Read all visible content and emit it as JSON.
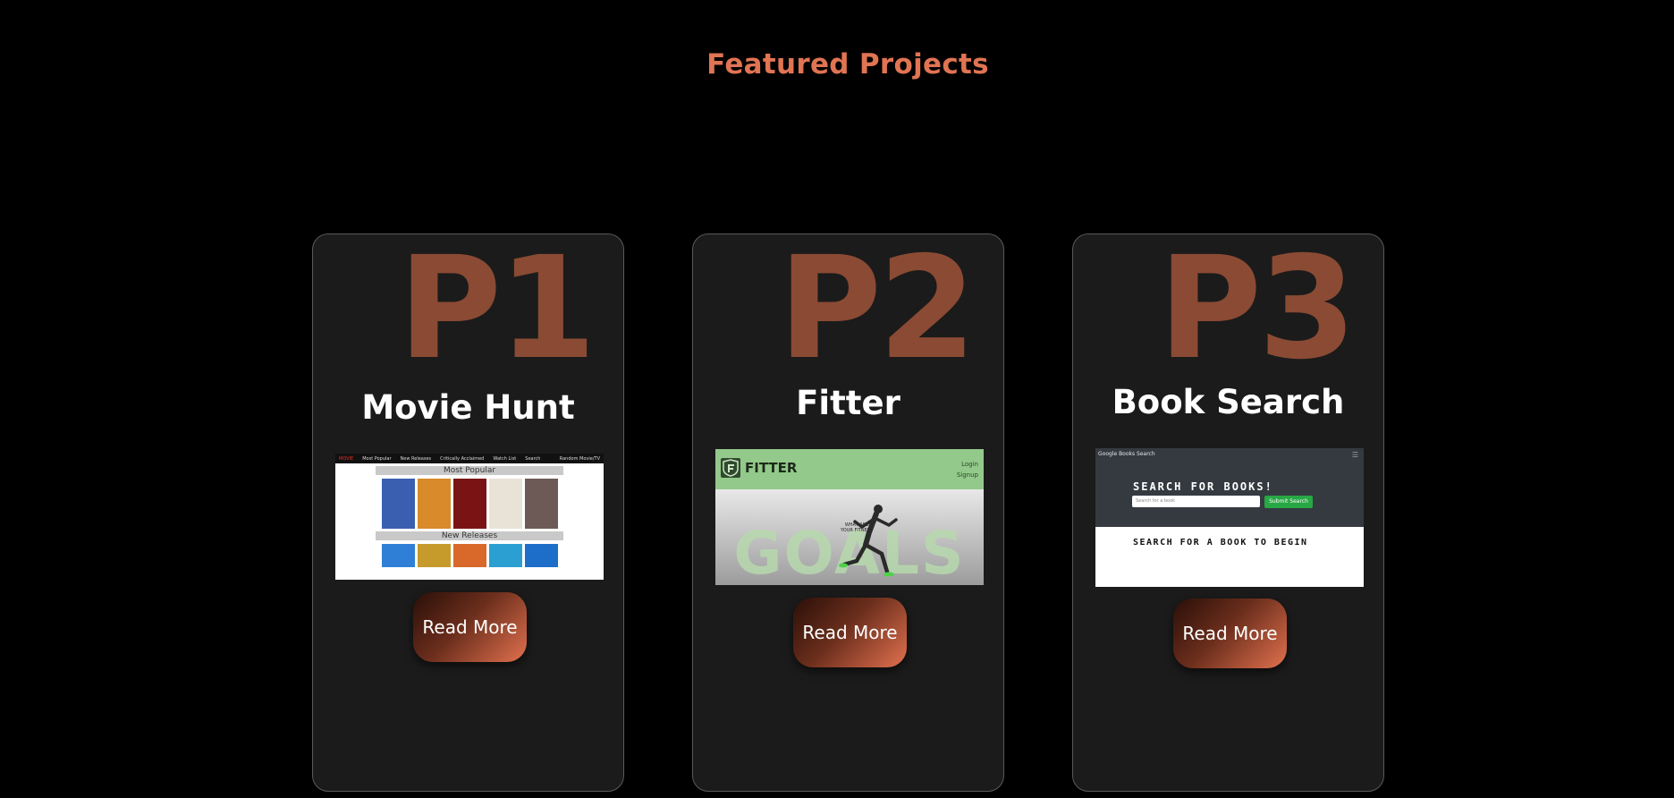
{
  "section": {
    "title": "Featured Projects"
  },
  "projects": [
    {
      "number": "P1",
      "title": "Movie Hunt",
      "button": "Read More",
      "screenshot": {
        "nav_items": [
          "MOVIE",
          "Most Popular",
          "New Releases",
          "Critically Acclaimed",
          "Watch List",
          "Search"
        ],
        "nav_right": "Random Movie/TV",
        "section_1": "Most Popular",
        "section_2": "New Releases",
        "poster_colors": [
          "#3a5fb0",
          "#d98a2b",
          "#7a1414",
          "#e9e3d7",
          "#6d5a56"
        ],
        "poster_colors_bottom": [
          "#2f7fd6",
          "#c79b2b",
          "#d8692b",
          "#2b9fd1",
          "#1d6ec9"
        ]
      }
    },
    {
      "number": "P2",
      "title": "Fitter",
      "button": "Read More",
      "screenshot": {
        "brand": "FITTER",
        "login": "Login",
        "signup": "Signup",
        "tagline_1": "WHAT ARE",
        "tagline_2": "YOUR FITNESS",
        "hero_word": "GOALS",
        "header_color": "#93c98a"
      }
    },
    {
      "number": "P3",
      "title": "Book Search",
      "button": "Read More",
      "screenshot": {
        "app_name": "Google Books Search",
        "menu_glyph": "☰",
        "headline": "SEARCH FOR BOOKS!",
        "input_placeholder": "Search for a book",
        "submit": "Submit Search",
        "empty_state": "SEARCH FOR A BOOK TO BEGIN"
      }
    }
  ],
  "colors": {
    "accent": "#e07453",
    "card_bg": "#1b1b1b",
    "number": "#8a4a33"
  }
}
